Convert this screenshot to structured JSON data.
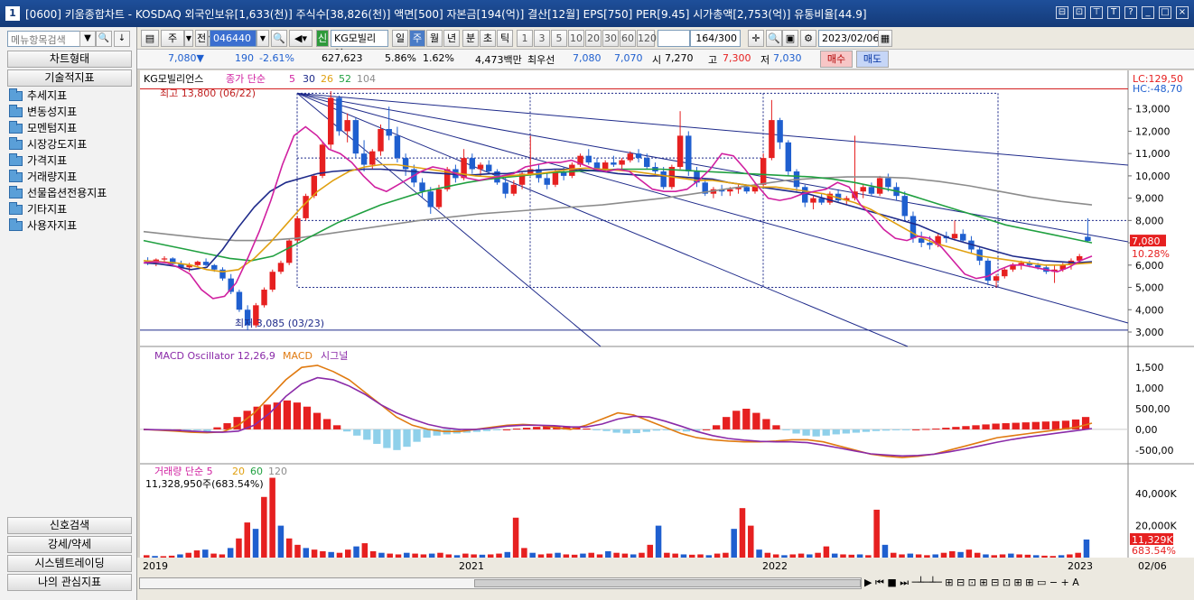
{
  "window": {
    "number": "1",
    "title": "[0600] 키움종합차트 - KOSDAQ 외국인보유[1,633(천)] 주식수[38,826(천)] 액면[500] 자본금[194(억)] 결산[12월] EPS[750] PER[9.45] 시가총액[2,753(억)] 유통비율[44.9]",
    "controls": [
      "⊟",
      "⊡",
      "⊤",
      "T",
      "?",
      "_",
      "□",
      "×"
    ]
  },
  "sidebar": {
    "search_placeholder": "메뉴항목검색",
    "chart_type": "차트형태",
    "tech_indicator": "기술적지표",
    "tree": [
      "추세지표",
      "변동성지표",
      "모멘텀지표",
      "시장강도지표",
      "가격지표",
      "거래량지표",
      "선물옵션전용지표",
      "기타지표",
      "사용자지표"
    ],
    "signal_search": "신호검색",
    "strength": "강세/약세",
    "system_trading": "시스템트레이딩",
    "my_indicators": "나의 관심지표"
  },
  "toolbar": {
    "freq_sel": "주",
    "prefix": "전",
    "code": "046440",
    "market_badge": "신",
    "stock_name": "KG모빌리언",
    "period_tabs": [
      "일",
      "주",
      "월",
      "년",
      "분",
      "초",
      "틱"
    ],
    "active_period": "주",
    "intervals": [
      "1",
      "3",
      "5",
      "10",
      "20",
      "30",
      "60",
      "120"
    ],
    "count": "164",
    "total": "/300",
    "date": "2023/02/06"
  },
  "quote": {
    "price": "7,080",
    "arrow": "▼",
    "change": "190",
    "change_pct": "-2.61%",
    "volume": "627,623",
    "vol_pct": "5.86%",
    "turnover_pct": "1.62%",
    "amount": "4,473백만",
    "best_label": "최우선",
    "ask": "7,080",
    "bid": "7,070",
    "open_label": "시",
    "open": "7,270",
    "high_label": "고",
    "high": "7,300",
    "low_label": "저",
    "low": "7,030",
    "buy": "매수",
    "sell": "매도"
  },
  "colors": {
    "up": "#e62020",
    "down": "#1f5fcf",
    "ma5": "#d020a0",
    "ma20": "#e0a010",
    "ma26": "#1e2a8a",
    "ma52": "#20a040",
    "ma104": "#8c8c8c",
    "macd": "#e07a10",
    "signal": "#8a2aa8"
  },
  "price_panel": {
    "legend_name": "KG모빌리언스",
    "legend_parts": [
      "종가 단순",
      "5",
      "30",
      "26",
      "52",
      "104"
    ],
    "max_label": "최고 13,800 (06/22)",
    "min_label": "최저 3,085 (03/23)",
    "lc_label": "LC:129,50",
    "hc_label": "HC:-48,70",
    "y_ticks": [
      "13,000",
      "12,000",
      "11,000",
      "10,000",
      "9,000",
      "8,000",
      "7,000",
      "6,000",
      "5,000",
      "4,000",
      "3,000"
    ],
    "last_price": "7,080",
    "last_pct": "10.28%"
  },
  "macd_panel": {
    "legend": "MACD Oscillator 12,26,9",
    "legend_macd": "MACD",
    "legend_signal": "시그널",
    "y_ticks": [
      "1,500",
      "1,000",
      "500,00",
      "0,00",
      "-500,00"
    ]
  },
  "volume_panel": {
    "legend": "거래량 단순 5",
    "legend_parts": [
      "20",
      "60",
      "120"
    ],
    "value_label": "11,328,950주(683.54%)",
    "y_ticks": [
      "40,000K",
      "20,000K"
    ],
    "last_vol": "11,329K",
    "last_pct": "683.54%"
  },
  "x_axis": {
    "labels": [
      "2019",
      "2021",
      "2022",
      "2023"
    ],
    "end_label": "02/06"
  },
  "chart_data": {
    "type": "candlestick",
    "title": "KG모빌리언스",
    "y_range": [
      3000,
      14000
    ],
    "candles": [
      [
        6200,
        6350,
        6000,
        6100
      ],
      [
        6100,
        6300,
        5950,
        6250
      ],
      [
        6250,
        6400,
        6150,
        6300
      ],
      [
        6300,
        6350,
        6000,
        6050
      ],
      [
        6050,
        6200,
        5800,
        5900
      ],
      [
        5900,
        6100,
        5700,
        6000
      ],
      [
        6000,
        6200,
        5900,
        6150
      ],
      [
        6150,
        6300,
        5950,
        6000
      ],
      [
        6000,
        6050,
        5700,
        5800
      ],
      [
        5800,
        5900,
        5300,
        5400
      ],
      [
        5400,
        5600,
        4700,
        4800
      ],
      [
        4800,
        4900,
        3900,
        4000
      ],
      [
        4000,
        4200,
        3085,
        3300
      ],
      [
        3300,
        4300,
        3200,
        4200
      ],
      [
        4200,
        5000,
        4100,
        4900
      ],
      [
        4900,
        5800,
        4800,
        5700
      ],
      [
        5700,
        6200,
        5600,
        6100
      ],
      [
        6100,
        7200,
        6000,
        7100
      ],
      [
        7100,
        8200,
        7000,
        8100
      ],
      [
        8100,
        9200,
        8000,
        9100
      ],
      [
        9100,
        10100,
        9000,
        10000
      ],
      [
        10000,
        11500,
        9900,
        11400
      ],
      [
        11400,
        13800,
        11200,
        13500
      ],
      [
        13500,
        13600,
        11800,
        12000
      ],
      [
        12000,
        12800,
        11500,
        12500
      ],
      [
        12500,
        12600,
        10800,
        11000
      ],
      [
        11000,
        11600,
        10200,
        10500
      ],
      [
        10500,
        11200,
        10300,
        11100
      ],
      [
        11100,
        12300,
        10900,
        12100
      ],
      [
        12100,
        13100,
        11600,
        11800
      ],
      [
        11800,
        12200,
        10600,
        10800
      ],
      [
        10800,
        11000,
        10000,
        10300
      ],
      [
        10300,
        10500,
        9500,
        9700
      ],
      [
        9700,
        9900,
        9000,
        9300
      ],
      [
        9300,
        9500,
        8300,
        8600
      ],
      [
        8600,
        9600,
        8500,
        9400
      ],
      [
        9400,
        10400,
        9300,
        10300
      ],
      [
        10300,
        10500,
        9700,
        9900
      ],
      [
        9900,
        11200,
        9800,
        10800
      ],
      [
        10800,
        11000,
        10100,
        10300
      ],
      [
        10300,
        10600,
        10000,
        10500
      ],
      [
        10500,
        10700,
        10100,
        10200
      ],
      [
        10200,
        10300,
        9600,
        9700
      ],
      [
        9700,
        9900,
        9000,
        9200
      ],
      [
        9200,
        9800,
        9100,
        9600
      ],
      [
        9600,
        10200,
        9400,
        10100
      ],
      [
        10100,
        11800,
        10000,
        10300
      ],
      [
        10300,
        10500,
        9700,
        9900
      ],
      [
        9900,
        10100,
        9400,
        9600
      ],
      [
        9600,
        10300,
        9500,
        10200
      ],
      [
        10200,
        10400,
        9800,
        10000
      ],
      [
        10000,
        10600,
        9900,
        10500
      ],
      [
        10500,
        11000,
        10400,
        10900
      ],
      [
        10900,
        11200,
        10500,
        10600
      ],
      [
        10600,
        10800,
        10200,
        10300
      ],
      [
        10300,
        10700,
        10200,
        10600
      ],
      [
        10600,
        10900,
        10400,
        10500
      ],
      [
        10500,
        10800,
        10300,
        10700
      ],
      [
        10700,
        11100,
        10600,
        11000
      ],
      [
        11000,
        11200,
        10600,
        10800
      ],
      [
        10800,
        11000,
        10300,
        10400
      ],
      [
        10400,
        10600,
        10000,
        10200
      ],
      [
        10200,
        10400,
        9400,
        9500
      ],
      [
        9500,
        10500,
        9400,
        10400
      ],
      [
        10400,
        12900,
        10300,
        11800
      ],
      [
        11800,
        12000,
        10000,
        10200
      ],
      [
        10200,
        10400,
        9500,
        9700
      ],
      [
        9700,
        9900,
        9100,
        9200
      ],
      [
        9200,
        9500,
        9000,
        9400
      ],
      [
        9400,
        9600,
        9100,
        9300
      ],
      [
        9300,
        9500,
        9100,
        9400
      ],
      [
        9400,
        9600,
        9200,
        9500
      ],
      [
        9500,
        9600,
        9200,
        9300
      ],
      [
        9300,
        9700,
        9200,
        9600
      ],
      [
        9600,
        11000,
        9500,
        10800
      ],
      [
        10800,
        13400,
        10700,
        12500
      ],
      [
        12500,
        12600,
        11200,
        11500
      ],
      [
        11500,
        11600,
        10000,
        10200
      ],
      [
        10200,
        10300,
        9300,
        9500
      ],
      [
        9500,
        9600,
        8600,
        8800
      ],
      [
        8800,
        9100,
        8500,
        9000
      ],
      [
        9000,
        9200,
        8700,
        8800
      ],
      [
        8800,
        9300,
        8700,
        9200
      ],
      [
        9200,
        9400,
        8800,
        8900
      ],
      [
        8900,
        9100,
        8700,
        9000
      ],
      [
        9000,
        11800,
        8900,
        9300
      ],
      [
        9300,
        9600,
        9000,
        9500
      ],
      [
        9500,
        9700,
        9100,
        9200
      ],
      [
        9200,
        10000,
        9100,
        9900
      ],
      [
        9900,
        10100,
        9300,
        9500
      ],
      [
        9500,
        9700,
        8900,
        9100
      ],
      [
        9100,
        9300,
        8000,
        8200
      ],
      [
        8200,
        8400,
        7000,
        7200
      ],
      [
        7200,
        7500,
        6800,
        7000
      ],
      [
        7000,
        7300,
        6700,
        6900
      ],
      [
        6900,
        7400,
        6800,
        7300
      ],
      [
        7300,
        7500,
        7000,
        7200
      ],
      [
        7200,
        8000,
        7100,
        7400
      ],
      [
        7400,
        7600,
        7000,
        7100
      ],
      [
        7100,
        7300,
        6500,
        6700
      ],
      [
        6700,
        6800,
        6000,
        6200
      ],
      [
        6200,
        6300,
        5100,
        5300
      ],
      [
        5300,
        5600,
        5000,
        5500
      ],
      [
        5500,
        5900,
        5400,
        5800
      ],
      [
        5800,
        6100,
        5700,
        6000
      ],
      [
        6000,
        6200,
        5800,
        6100
      ],
      [
        6100,
        6200,
        5900,
        6000
      ],
      [
        6000,
        6100,
        5800,
        5900
      ],
      [
        5900,
        6000,
        5600,
        5700
      ],
      [
        5700,
        6000,
        5200,
        5800
      ],
      [
        5800,
        6100,
        5700,
        6000
      ],
      [
        6000,
        6300,
        5800,
        6200
      ],
      [
        6200,
        6500,
        6100,
        6400
      ],
      [
        7270,
        8100,
        7030,
        7080
      ]
    ],
    "ma5": [
      6100,
      6150,
      6100,
      5900,
      5600,
      4900,
      4500,
      4600,
      5200,
      6300,
      7500,
      8900,
      10500,
      11800,
      12200,
      11800,
      11200,
      11000,
      10600,
      10000,
      9500,
      9300,
      9600,
      9900,
      10200,
      10400,
      10300,
      10100,
      9900,
      9800,
      9900,
      10000,
      10100,
      10400,
      10500,
      10600,
      10600,
      10700,
      10500,
      10300,
      10200,
      10300,
      10200,
      9800,
      9400,
      9300,
      9300,
      9400,
      9800,
      10300,
      11000,
      10900,
      10300,
      9600,
      9000,
      8900,
      9000,
      9200,
      9300,
      9400,
      9700,
      9500,
      8700,
      8200,
      7600,
      7200,
      7100,
      7300,
      7200,
      6800,
      6200,
      5600,
      5400,
      5500,
      5800,
      6000,
      6000,
      5900,
      5800,
      5700,
      5900,
      6200,
      6400
    ],
    "ma20": [
      6200,
      6150,
      6100,
      6000,
      5800,
      5700,
      5800,
      6300,
      7000,
      7800,
      8600,
      9300,
      9800,
      10200,
      10400,
      10500,
      10500,
      10400,
      10300,
      10200,
      10100,
      10000,
      9950,
      10000,
      10050,
      10100,
      10200,
      10300,
      10350,
      10300,
      10250,
      10200,
      10100,
      10000,
      9900,
      9800,
      9800,
      9700,
      9600,
      9500,
      9500,
      9400,
      9300,
      9200,
      9000,
      8800,
      8500,
      8100,
      7700,
      7300,
      7000,
      6800,
      6600,
      6400,
      6300,
      6200,
      6100,
      6000,
      6000,
      6050,
      6100
    ],
    "ma30": [
      6100,
      6050,
      5950,
      5800,
      5900,
      6700,
      7700,
      8600,
      9300,
      9700,
      9900,
      10100,
      10200,
      10250,
      10300,
      10300,
      10250,
      10200,
      10150,
      10100,
      10050,
      10050,
      10100,
      10100,
      10200,
      10250,
      10300,
      10300,
      10250,
      10200,
      10100,
      10050,
      10000,
      10000,
      9950,
      9900,
      9850,
      9700,
      9600,
      9500,
      9400,
      9300,
      9200,
      9000,
      8800,
      8600,
      8400,
      8200,
      8000,
      7800,
      7500,
      7200,
      7000,
      6800,
      6600,
      6400,
      6300,
      6200,
      6150,
      6100,
      6150
    ],
    "ma52": [
      7100,
      6900,
      6700,
      6500,
      6300,
      6200,
      6400,
      6900,
      7400,
      7900,
      8300,
      8700,
      9000,
      9300,
      9500,
      9700,
      9850,
      9950,
      10050,
      10150,
      10200,
      10250,
      10300,
      10300,
      10300,
      10250,
      10200,
      10150,
      10100,
      10050,
      10000,
      9950,
      9850,
      9700,
      9500,
      9300,
      9000,
      8700,
      8400,
      8100,
      7800,
      7600,
      7400,
      7200,
      7000
    ],
    "ma104": [
      7500,
      7350,
      7200,
      7100,
      7100,
      7200,
      7400,
      7600,
      7800,
      8000,
      8150,
      8300,
      8400,
      8500,
      8600,
      8700,
      8850,
      9000,
      9200,
      9400,
      9600,
      9800,
      9900,
      9950,
      9950,
      9900,
      9750,
      9550,
      9300,
      9050,
      8850,
      8700
    ],
    "macd_osc": [
      0,
      0,
      0,
      0,
      -10,
      -20,
      -50,
      50,
      150,
      300,
      450,
      550,
      600,
      650,
      700,
      650,
      550,
      400,
      250,
      100,
      -50,
      -150,
      -250,
      -350,
      -450,
      -500,
      -420,
      -300,
      -200,
      -150,
      -120,
      -100,
      -80,
      -60,
      -40,
      -20,
      0,
      20,
      40,
      60,
      80,
      90,
      80,
      50,
      20,
      -10,
      -40,
      -80,
      -100,
      -90,
      -60,
      -30,
      -20,
      -30,
      -50,
      -40,
      0,
      100,
      300,
      450,
      500,
      400,
      250,
      100,
      -20,
      -100,
      -150,
      -170,
      -150,
      -120,
      -100,
      -80,
      -60,
      -40,
      -30,
      -20,
      -10,
      0,
      10,
      20,
      40,
      60,
      80,
      100,
      120,
      140,
      150,
      160,
      170,
      180,
      190,
      200,
      210,
      240,
      300
    ],
    "macd": [
      0,
      -20,
      -40,
      -70,
      -80,
      -60,
      100,
      400,
      800,
      1200,
      1500,
      1550,
      1400,
      1200,
      900,
      600,
      300,
      100,
      0,
      -50,
      -50,
      0,
      50,
      100,
      120,
      100,
      50,
      0,
      100,
      250,
      400,
      350,
      200,
      50,
      -100,
      -200,
      -250,
      -280,
      -300,
      -300,
      -280,
      -250,
      -250,
      -300,
      -400,
      -500,
      -600,
      -650,
      -680,
      -650,
      -600,
      -500,
      -400,
      -300,
      -200,
      -150,
      -100,
      -50,
      0,
      50,
      150
    ],
    "signal": [
      0,
      -10,
      -20,
      -40,
      -60,
      -70,
      -40,
      100,
      400,
      800,
      1100,
      1250,
      1200,
      1050,
      850,
      600,
      400,
      250,
      120,
      40,
      0,
      0,
      30,
      80,
      100,
      100,
      90,
      60,
      60,
      130,
      250,
      320,
      300,
      200,
      80,
      -50,
      -150,
      -220,
      -260,
      -290,
      -300,
      -300,
      -320,
      -380,
      -450,
      -520,
      -590,
      -620,
      -640,
      -630,
      -600,
      -540,
      -470,
      -390,
      -310,
      -240,
      -180,
      -130,
      -80,
      -30,
      20
    ],
    "volume_k": [
      1500,
      1000,
      900,
      1200,
      2000,
      3000,
      4500,
      5000,
      2500,
      2000,
      6000,
      12000,
      22000,
      18000,
      38000,
      50000,
      20000,
      12000,
      8000,
      6000,
      5000,
      4000,
      3500,
      3000,
      5000,
      7000,
      9000,
      4000,
      3000,
      2500,
      2000,
      3000,
      2500,
      2000,
      2500,
      3000,
      2000,
      1500,
      2500,
      2000,
      1800,
      2000,
      2500,
      3500,
      25000,
      6000,
      3000,
      2000,
      2500,
      3000,
      2000,
      1800,
      2500,
      3000,
      2000,
      4000,
      3000,
      2500,
      2000,
      3000,
      8000,
      20000,
      3000,
      2500,
      2000,
      1800,
      2000,
      1500,
      2500,
      3000,
      18000,
      31000,
      20000,
      5000,
      3000,
      2000,
      1500,
      2000,
      2500,
      2000,
      3000,
      7000,
      2500,
      2000,
      1800,
      2000,
      1500,
      30000,
      8000,
      3000,
      2000,
      2500,
      2000,
      1500,
      2000,
      3000,
      4000,
      3500,
      5000,
      3000,
      2000,
      1500,
      2000,
      2500,
      2000,
      1800,
      1500,
      1200,
      1000,
      1500,
      2000,
      3000,
      11329
    ]
  }
}
